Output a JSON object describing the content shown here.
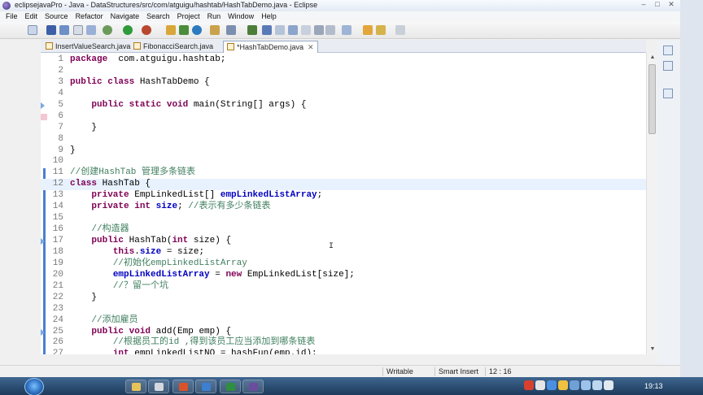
{
  "window": {
    "title": "eclipsejavaPro - Java - DataStructures/src/com/atguigu/hashtab/HashTabDemo.java - Eclipse",
    "controls": [
      "–",
      "□",
      "✕"
    ]
  },
  "menu": [
    "File",
    "Edit",
    "Source",
    "Refactor",
    "Navigate",
    "Search",
    "Project",
    "Run",
    "Window",
    "Help"
  ],
  "tabs": [
    {
      "label": "InsertValueSearch.java",
      "active": false
    },
    {
      "label": "FibonacciSearch.java",
      "active": false
    },
    {
      "label": "*HashTabDemo.java",
      "active": true,
      "close": "✕"
    }
  ],
  "editor": {
    "lines": [
      {
        "n": "1",
        "parts": [
          [
            "kw",
            "package"
          ],
          [
            "",
            "  com.atguigu.hashtab;"
          ]
        ]
      },
      {
        "n": "2",
        "parts": []
      },
      {
        "n": "3",
        "parts": [
          [
            "kw",
            "public"
          ],
          [
            "",
            " "
          ],
          [
            "kw",
            "class"
          ],
          [
            "",
            " HashTabDemo {"
          ]
        ]
      },
      {
        "n": "4",
        "parts": []
      },
      {
        "n": "5",
        "parts": [
          [
            "",
            "    "
          ],
          [
            "kw",
            "public"
          ],
          [
            "",
            " "
          ],
          [
            "kw",
            "static"
          ],
          [
            "",
            " "
          ],
          [
            "kw",
            "void"
          ],
          [
            "",
            " main(String[] args) {"
          ]
        ],
        "bp": "arrow"
      },
      {
        "n": "6",
        "parts": [],
        "bp": "pink"
      },
      {
        "n": "7",
        "parts": [
          [
            "",
            "    }"
          ]
        ]
      },
      {
        "n": "8",
        "parts": []
      },
      {
        "n": "9",
        "parts": [
          [
            "",
            "}"
          ]
        ]
      },
      {
        "n": "10",
        "parts": []
      },
      {
        "n": "11",
        "parts": [
          [
            "cm",
            "//创建HashTab 管理多条链表"
          ]
        ]
      },
      {
        "n": "12",
        "parts": [
          [
            "kw",
            "class"
          ],
          [
            "",
            " HashTab {"
          ]
        ],
        "current": true
      },
      {
        "n": "13",
        "parts": [
          [
            "",
            "    "
          ],
          [
            "kw",
            "private"
          ],
          [
            "",
            " EmpLinkedList[] "
          ],
          [
            "fd",
            "empLinkedListArray"
          ],
          [
            "",
            ";"
          ]
        ]
      },
      {
        "n": "14",
        "parts": [
          [
            "",
            "    "
          ],
          [
            "kw",
            "private"
          ],
          [
            "",
            " "
          ],
          [
            "kw",
            "int"
          ],
          [
            "",
            " "
          ],
          [
            "fd",
            "size"
          ],
          [
            "",
            "; "
          ],
          [
            "cm",
            "//表示有多少条链表"
          ]
        ]
      },
      {
        "n": "15",
        "parts": []
      },
      {
        "n": "16",
        "parts": [
          [
            "",
            "    "
          ],
          [
            "cm",
            "//构造器"
          ]
        ]
      },
      {
        "n": "17",
        "parts": [
          [
            "",
            "    "
          ],
          [
            "kw",
            "public"
          ],
          [
            "",
            " HashTab("
          ],
          [
            "kw",
            "int"
          ],
          [
            "",
            " size) {"
          ]
        ],
        "bp": "arrow"
      },
      {
        "n": "18",
        "parts": [
          [
            "",
            "        "
          ],
          [
            "kw",
            "this"
          ],
          [
            "",
            "."
          ],
          [
            "fd",
            "size"
          ],
          [
            "",
            " = size;"
          ]
        ]
      },
      {
        "n": "19",
        "parts": [
          [
            "",
            "        "
          ],
          [
            "cm",
            "//初始化empLinkedListArray"
          ]
        ]
      },
      {
        "n": "20",
        "parts": [
          [
            "",
            "        "
          ],
          [
            "fd",
            "empLinkedListArray"
          ],
          [
            "",
            " = "
          ],
          [
            "kw",
            "new"
          ],
          [
            "",
            " EmpLinkedList[size];"
          ]
        ]
      },
      {
        "n": "21",
        "parts": [
          [
            "",
            "        "
          ],
          [
            "cm",
            "//？留一个坑"
          ]
        ]
      },
      {
        "n": "22",
        "parts": [
          [
            "",
            "    }"
          ]
        ]
      },
      {
        "n": "23",
        "parts": []
      },
      {
        "n": "24",
        "parts": [
          [
            "",
            "    "
          ],
          [
            "cm",
            "//添加雇员"
          ]
        ]
      },
      {
        "n": "25",
        "parts": [
          [
            "",
            "    "
          ],
          [
            "kw",
            "public"
          ],
          [
            "",
            " "
          ],
          [
            "kw",
            "void"
          ],
          [
            "",
            " add(Emp emp) {"
          ]
        ],
        "bp": "arrow"
      },
      {
        "n": "26",
        "parts": [
          [
            "",
            "        "
          ],
          [
            "cm",
            "//根据员工的id ,得到该员工应当添加到哪条链表"
          ]
        ]
      },
      {
        "n": "27",
        "parts": [
          [
            "",
            "        "
          ],
          [
            "kw",
            "int"
          ],
          [
            "",
            " empLinkedListNO = hashFun(emp.id);"
          ]
        ]
      }
    ]
  },
  "status": {
    "writable": "Writable",
    "insert_mode": "Smart Insert",
    "position": "12 : 16"
  },
  "taskbar": {
    "clock": "19:13"
  }
}
